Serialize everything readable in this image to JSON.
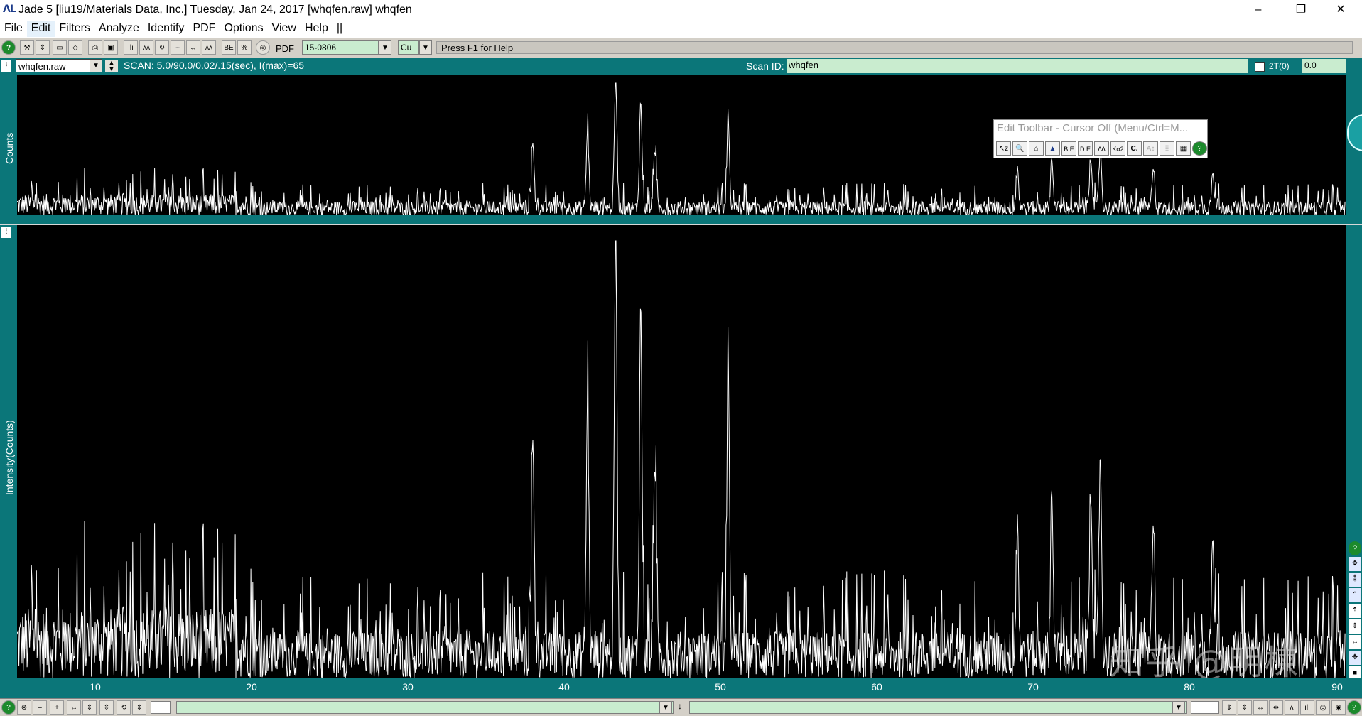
{
  "window": {
    "logo": "ΛL",
    "title": "Jade 5 [liu19/Materials Data, Inc.] Tuesday, Jan 24, 2017 [whqfen.raw] whqfen",
    "minimize": "–",
    "restore": "❐",
    "close": "✕"
  },
  "menu": {
    "items": [
      "File",
      "Edit",
      "Filters",
      "Analyze",
      "Identify",
      "PDF",
      "Options",
      "View",
      "Help",
      "||"
    ]
  },
  "toolbar": {
    "pdf_label": "PDF=",
    "pdf_value": "15-0806",
    "radiation_value": "Cu",
    "help_text": "Press F1 for Help"
  },
  "scan": {
    "file": "whqfen.raw",
    "info": "SCAN: 5.0/90.0/0.02/.15(sec), I(max)=65",
    "id_label": "Scan ID:",
    "id_value": "whqfen",
    "twotheta_label": "2T(0)=",
    "twotheta_value": "0.0"
  },
  "top_panel": {
    "ylabel": "Counts"
  },
  "main_panel": {
    "ylabel": "Intensity(Counts)"
  },
  "edit_toolbar": {
    "title": "Edit Toolbar - Cursor Off (Menu/Ctrl=M...",
    "buttons": [
      "↖z",
      "🔍",
      "⌂",
      "▲",
      "B.E",
      "D.E",
      "ʌʌ",
      "Kα2",
      "C.",
      "A↕",
      "⁞⁞",
      "▦",
      "?"
    ]
  },
  "xaxis": {
    "ticks": [
      "10",
      "20",
      "30",
      "40",
      "50",
      "60",
      "70",
      "80",
      "90"
    ]
  },
  "watermark": "知乎 @明楝",
  "colors": {
    "teal": "#0b7679",
    "plot_background": "#000000",
    "trace": "#ffffff",
    "field_green": "#c9eccf",
    "toolbar_gray": "#d4d0c8"
  },
  "chart_data": {
    "type": "line",
    "title": "",
    "xlabel": "",
    "ylabel": "Intensity(Counts)",
    "xlim": [
      5,
      90
    ],
    "ylim": [
      0,
      65
    ],
    "noise_level": 10,
    "peaks": [
      {
        "x": 38.0,
        "y": 32
      },
      {
        "x": 41.5,
        "y": 38
      },
      {
        "x": 43.3,
        "y": 65
      },
      {
        "x": 44.9,
        "y": 51
      },
      {
        "x": 45.8,
        "y": 30
      },
      {
        "x": 50.5,
        "y": 40
      },
      {
        "x": 69.0,
        "y": 18
      },
      {
        "x": 71.2,
        "y": 24
      },
      {
        "x": 73.7,
        "y": 26
      },
      {
        "x": 74.3,
        "y": 29
      },
      {
        "x": 77.7,
        "y": 22
      },
      {
        "x": 81.5,
        "y": 20
      }
    ]
  }
}
